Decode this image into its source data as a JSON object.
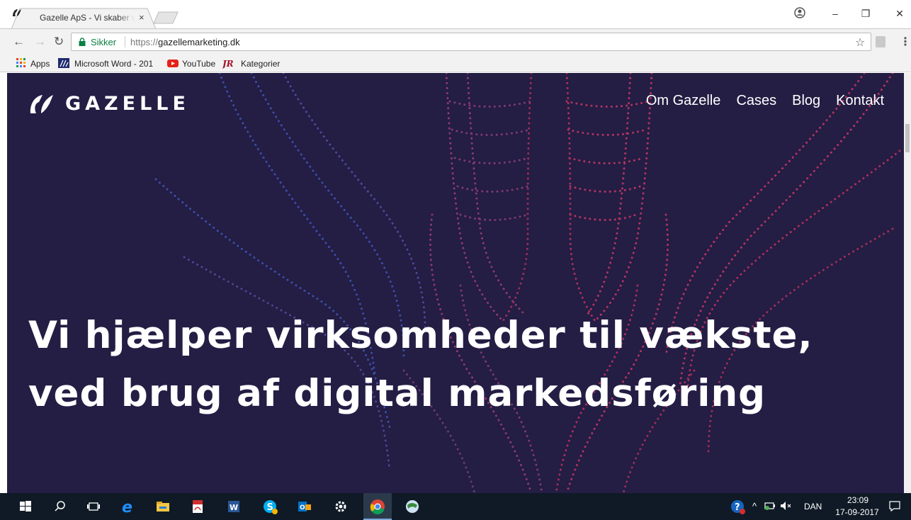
{
  "browser": {
    "tab_title": "Gazelle ApS - Vi skaber vækst",
    "tab_close": "×",
    "secure_label": "Sikker",
    "url_scheme": "https://",
    "url_host": "gazellemarketing.dk",
    "bookmarks": [
      {
        "label": "Apps",
        "icon": "apps-grid-icon"
      },
      {
        "label": "Microsoft Word - 201",
        "icon": "word-doc-icon"
      },
      {
        "label": "YouTube",
        "icon": "youtube-icon"
      },
      {
        "label": "Kategorier",
        "icon": "kategorier-icon"
      }
    ]
  },
  "site": {
    "logo_text": "GAZELLE",
    "nav": [
      "Om Gazelle",
      "Cases",
      "Blog",
      "Kontakt"
    ],
    "hero_line1": "Vi hjælper virksomheder til vækste,",
    "hero_line2": "ved brug af digital markedsføring",
    "colors": {
      "background": "#241d44",
      "accent_red": "#c0365f",
      "accent_blue": "#3b4a9c",
      "text": "#ffffff"
    }
  },
  "taskbar": {
    "apps": [
      "windows-start-icon",
      "search-icon",
      "task-view-icon",
      "internet-explorer-icon",
      "file-explorer-icon",
      "pdf-reader-icon",
      "word-icon",
      "skype-icon",
      "outlook-icon",
      "settings-icon",
      "chrome-icon",
      "network-globe-icon"
    ],
    "language": "DAN",
    "time": "23:09",
    "date": "17-09-2017"
  }
}
